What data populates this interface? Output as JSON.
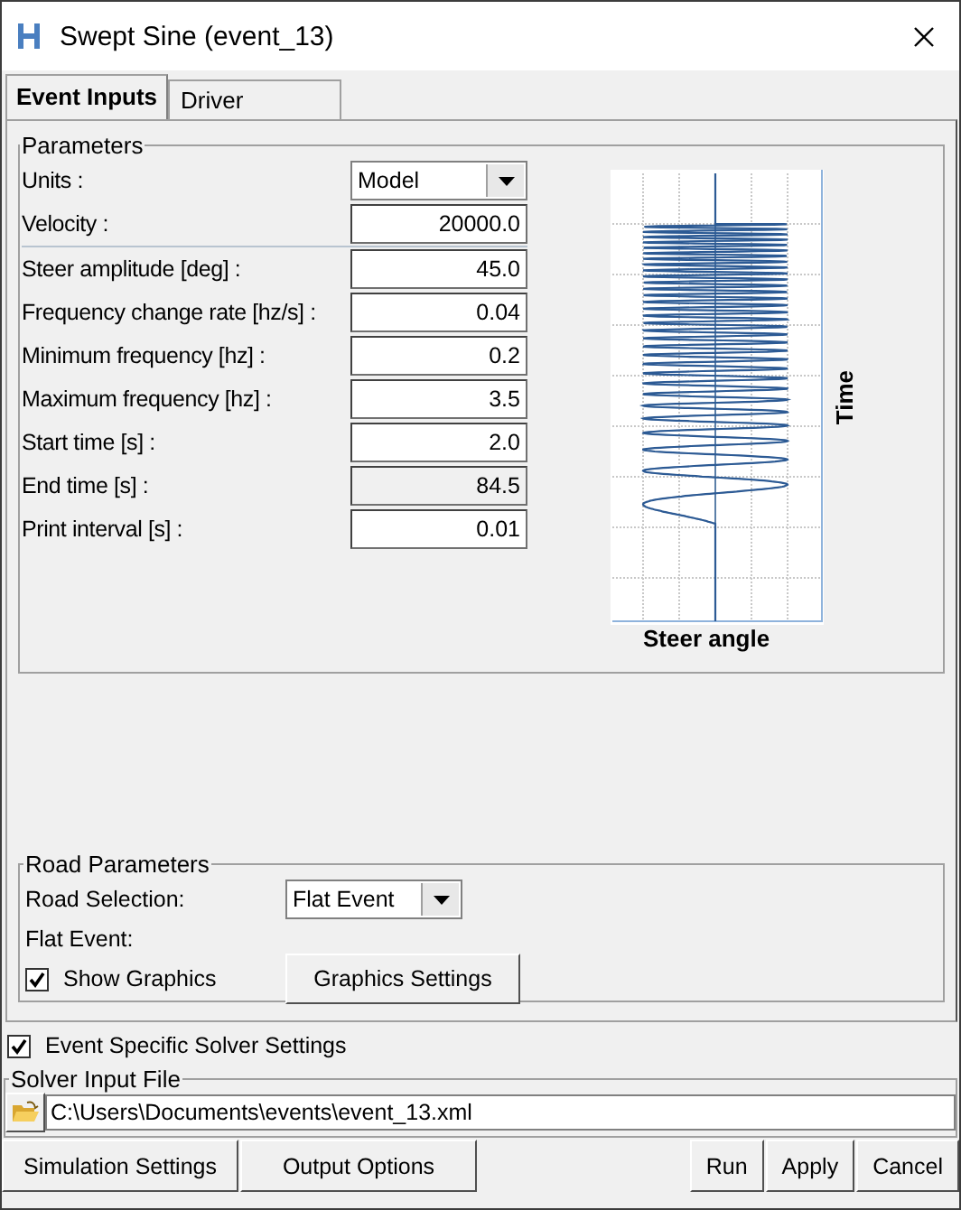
{
  "window": {
    "title": "Swept Sine (event_13)"
  },
  "tabs": [
    {
      "label": "Event Inputs",
      "selected": true
    },
    {
      "label": "Driver",
      "selected": false
    }
  ],
  "parameters": {
    "title": "Parameters",
    "fields": [
      {
        "label": "Units :",
        "kind": "dropdown",
        "value": "Model"
      },
      {
        "label": "Velocity :",
        "kind": "entry",
        "value": "20000.0",
        "disabled": false
      },
      {
        "label": "Steer amplitude [deg] :",
        "kind": "entry",
        "value": "45.0",
        "disabled": false
      },
      {
        "label": "Frequency change rate [hz/s] :",
        "kind": "entry",
        "value": "0.04",
        "disabled": false
      },
      {
        "label": "Minimum frequency [hz] :",
        "kind": "entry",
        "value": "0.2",
        "disabled": false
      },
      {
        "label": "Maximum frequency [hz] :",
        "kind": "entry",
        "value": "3.5",
        "disabled": false
      },
      {
        "label": "Start time [s] :",
        "kind": "entry",
        "value": "2.0",
        "disabled": false
      },
      {
        "label": "End time [s] :",
        "kind": "entry",
        "value": "84.5",
        "disabled": true
      },
      {
        "label": "Print interval [s] :",
        "kind": "entry",
        "value": "0.01",
        "disabled": false
      }
    ]
  },
  "steer_plot": {
    "x_label": "Steer angle",
    "y_label": "Time"
  },
  "road_parameters": {
    "title": "Road Parameters",
    "road_selection": {
      "label": "Road Selection:",
      "value": "Flat Event"
    },
    "flat_event_label": "Flat Event:",
    "show_graphics": {
      "label": "Show Graphics",
      "checked": true
    },
    "graphics_settings_button": "Graphics Settings"
  },
  "event_specific_solver_settings": {
    "label": "Event Specific Solver Settings",
    "checked": true
  },
  "solver_input_file": {
    "title": "Solver Input File",
    "value": "C:\\Users\\Documents\\events\\event_13.xml"
  },
  "buttons_left": [
    "Simulation Settings",
    "Output Options"
  ],
  "buttons_right": [
    "Run",
    "Apply",
    "Cancel"
  ]
}
